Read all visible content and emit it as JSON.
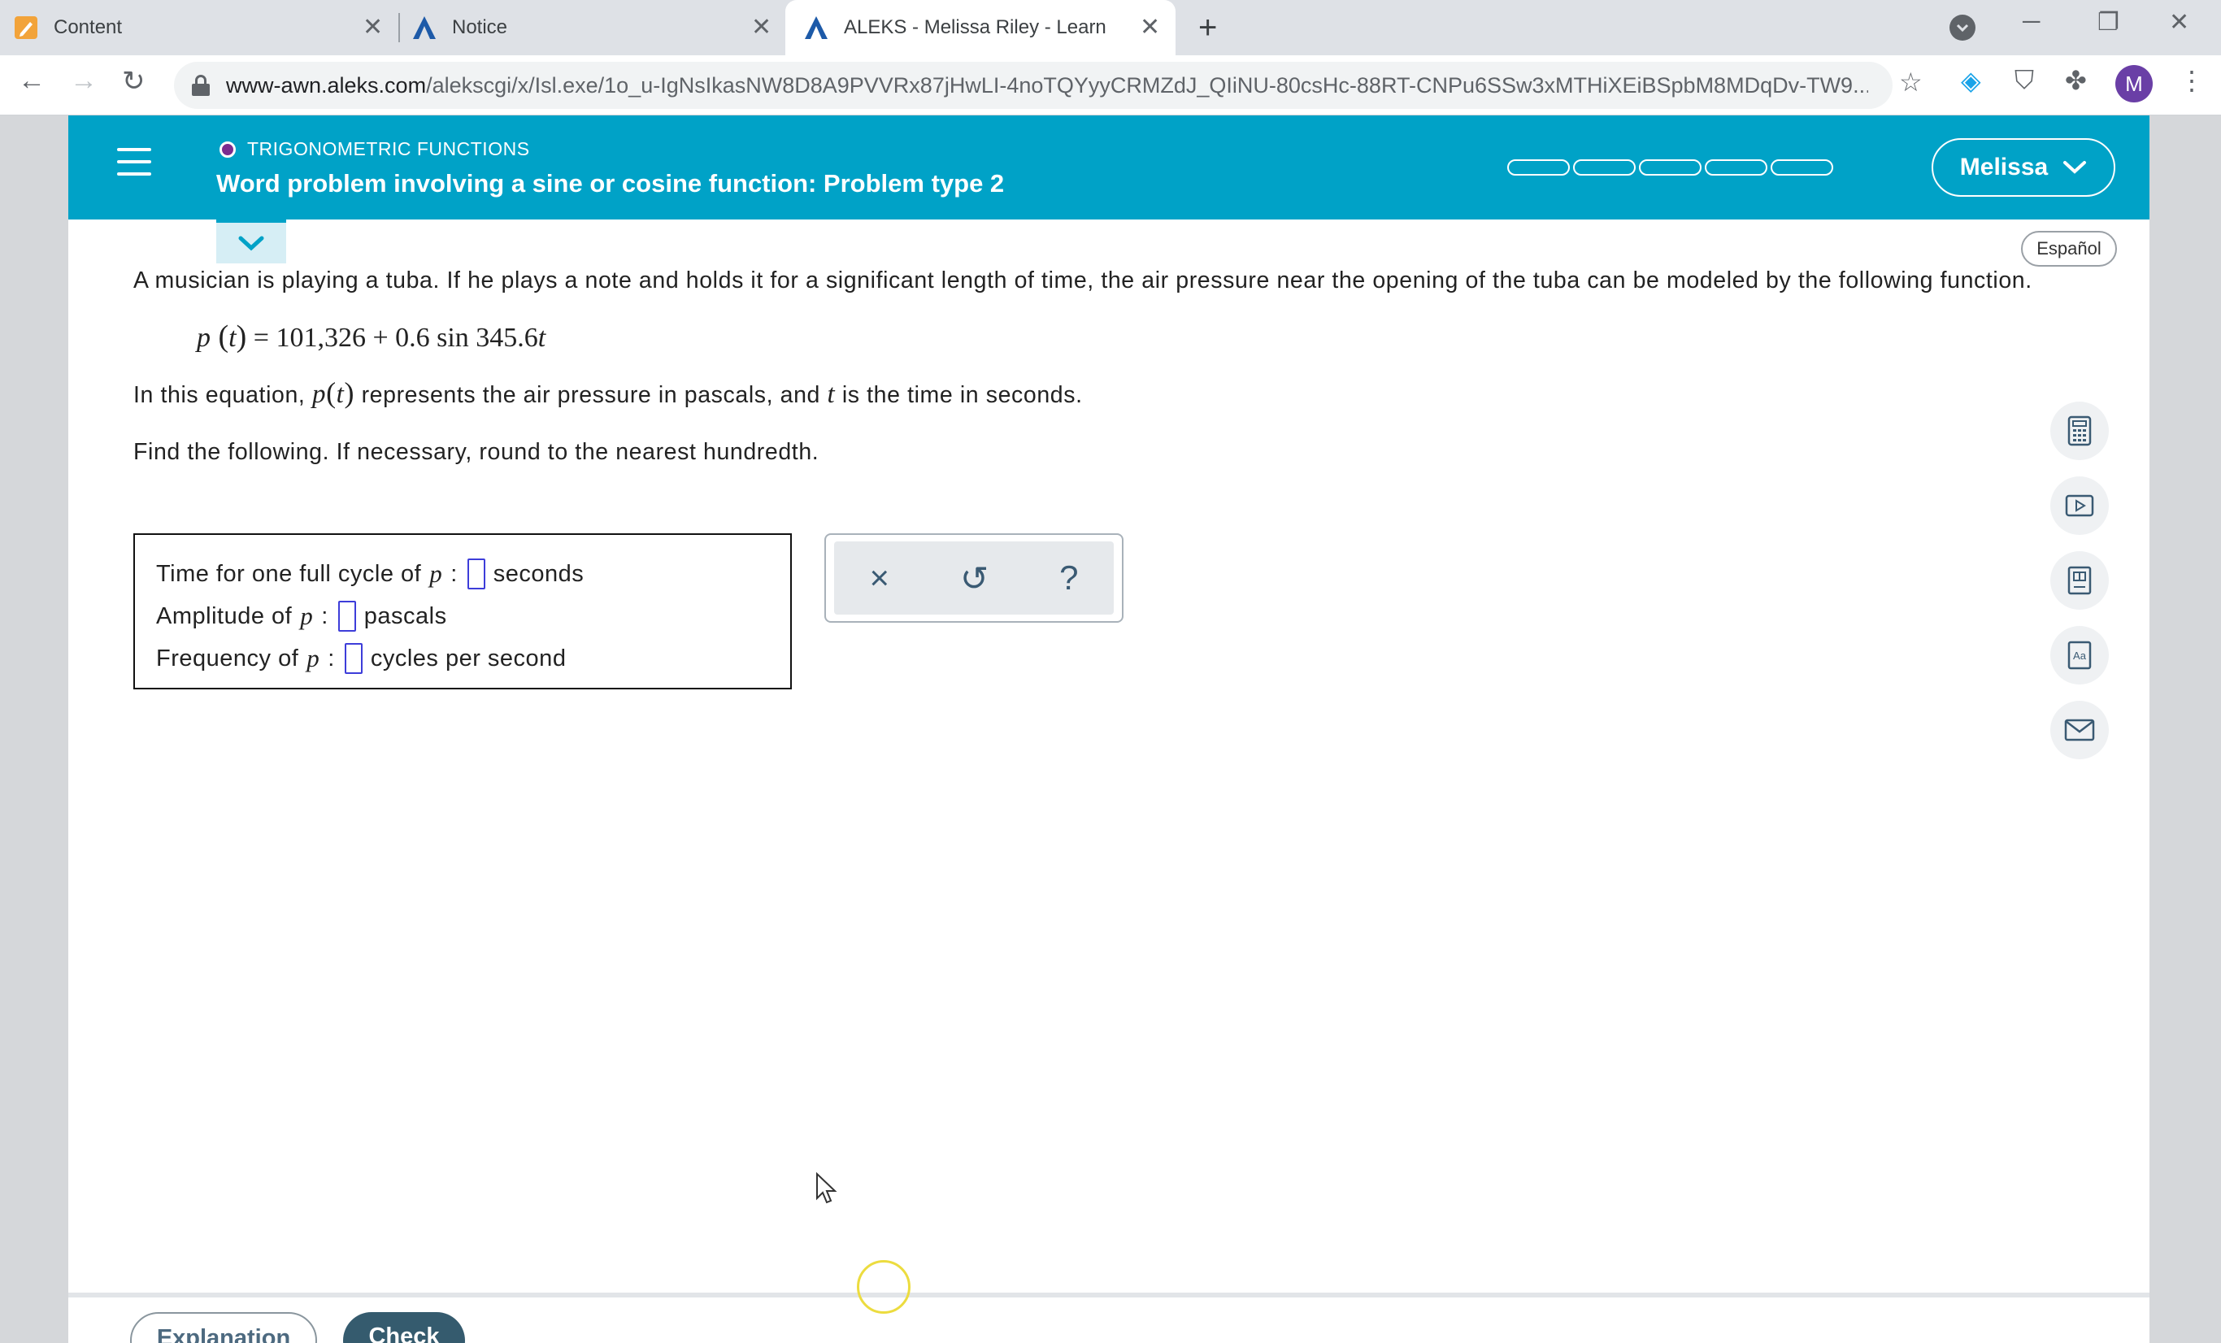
{
  "browser": {
    "tabs": [
      {
        "title": "Content"
      },
      {
        "title": "Notice"
      },
      {
        "title": "ALEKS - Melissa Riley - Learn"
      }
    ],
    "url_host": "www-awn.aleks.com",
    "url_path": "/alekscgi/x/Isl.exe/1o_u-IgNsIkasNW8D8A9PVVRx87jHwLI-4noTQYyyCRMZdJ_QIiNU-80csHc-88RT-CNPu6SSw3xMTHiXEiBSpbM8MDqDv-TW9...",
    "profile_initial": "M"
  },
  "header": {
    "topic": "TRIGONOMETRIC FUNCTIONS",
    "title": "Word problem involving a sine or cosine function: Problem type 2",
    "user": "Melissa",
    "progress_filled": 0
  },
  "language_button": "Español",
  "problem": {
    "intro": "A musician is playing a tuba. If he plays a note and holds it for a significant length of time, the air pressure near the opening of the tuba can be modeled by the following function.",
    "equation_lhs_var": "p",
    "equation_lhs_arg": "t",
    "equation_rhs": "= 101,326 + 0.6  sin 345.6",
    "equation_rhs_var": "t",
    "explain_prefix": "In this equation,",
    "explain_func": "p",
    "explain_arg": "t",
    "explain_mid": "represents the air pressure in pascals, and",
    "explain_var": "t",
    "explain_suffix": "is the time in seconds.",
    "instruction": "Find the following. If necessary, round to the nearest hundredth."
  },
  "answers": [
    {
      "label": "Time for one full cycle of",
      "var": "p",
      "colon": ":",
      "value": "",
      "unit": "seconds"
    },
    {
      "label": "Amplitude of",
      "var": "p",
      "colon": ":",
      "value": "",
      "unit": "pascals"
    },
    {
      "label": "Frequency of",
      "var": "p",
      "colon": ":",
      "value": "",
      "unit": "cycles per second"
    }
  ],
  "tools": {
    "clear": "×",
    "undo": "↺",
    "help": "?"
  },
  "footer": {
    "explanation": "Explanation",
    "check": "Check"
  }
}
